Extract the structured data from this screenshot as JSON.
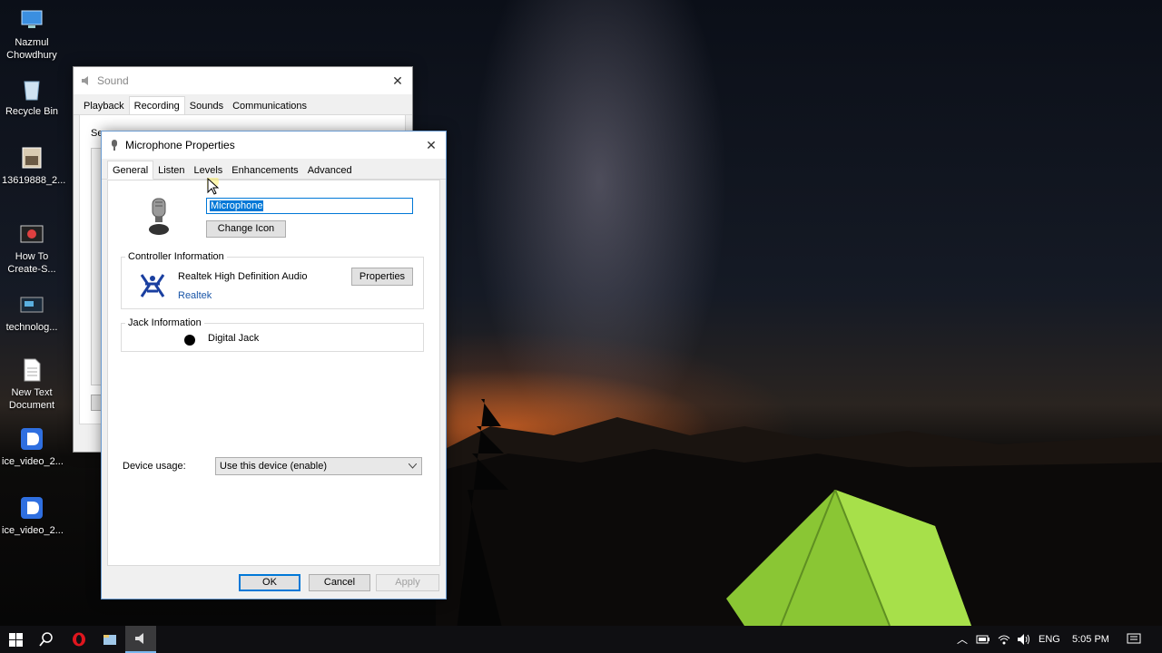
{
  "desktop": {
    "icons": [
      {
        "label": "Nazmul Chowdhury"
      },
      {
        "label": "Recycle Bin"
      },
      {
        "label": "13619888_2..."
      },
      {
        "label": "How To Create-S..."
      },
      {
        "label": "technolog..."
      },
      {
        "label": "New Text Document"
      },
      {
        "label": "ice_video_2..."
      },
      {
        "label": "ice_video_2..."
      }
    ]
  },
  "sound_window": {
    "title": "Sound",
    "tabs": [
      "Playback",
      "Recording",
      "Sounds",
      "Communications"
    ],
    "active_tab": "Recording",
    "partial_text": "Se"
  },
  "props_window": {
    "title": "Microphone Properties",
    "tabs": [
      "General",
      "Listen",
      "Levels",
      "Enhancements",
      "Advanced"
    ],
    "active_tab": "General",
    "name_value": "Microphone",
    "change_icon_label": "Change Icon",
    "controller": {
      "group_label": "Controller Information",
      "device_name": "Realtek High Definition Audio",
      "vendor_link": "Realtek",
      "properties_label": "Properties"
    },
    "jack": {
      "group_label": "Jack Information",
      "jack_name": "Digital Jack"
    },
    "device_usage": {
      "label": "Device usage:",
      "selected": "Use this device (enable)"
    },
    "buttons": {
      "ok": "OK",
      "cancel": "Cancel",
      "apply": "Apply"
    }
  },
  "taskbar": {
    "language": "ENG",
    "time": "5:05 PM"
  },
  "colors": {
    "accent": "#0078d7",
    "link": "#1a56a8",
    "selection": "#0078d7"
  }
}
